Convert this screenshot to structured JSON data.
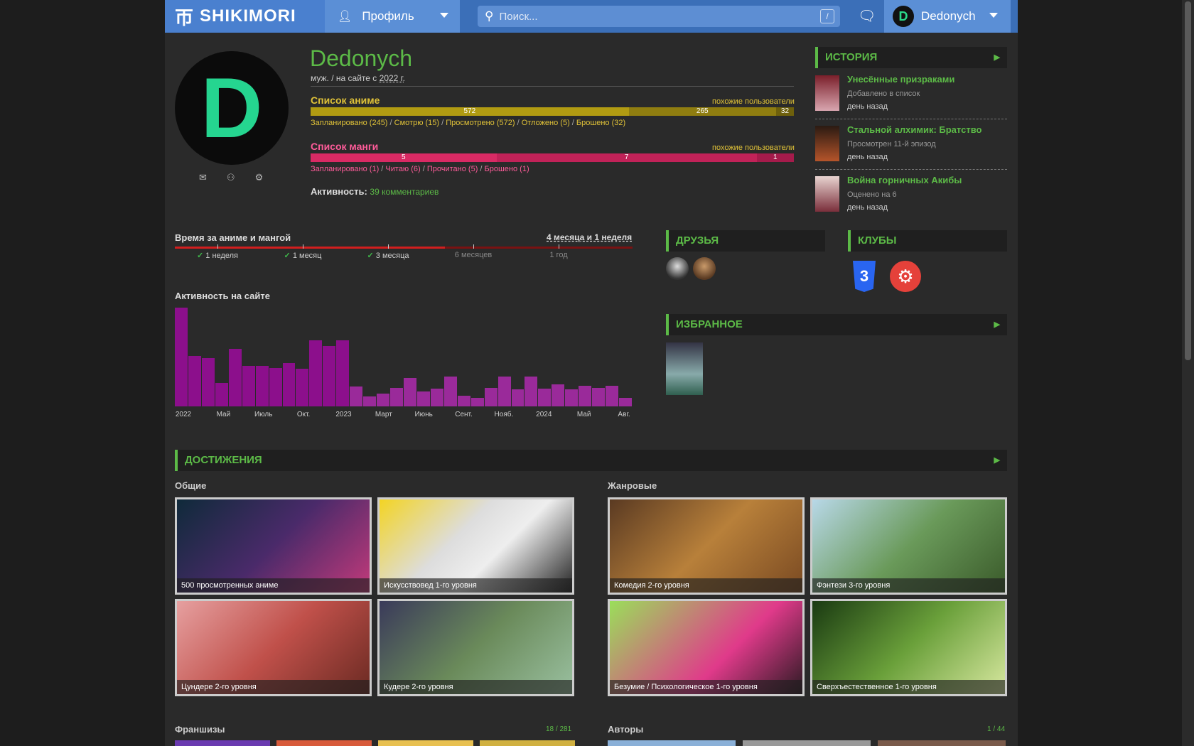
{
  "header": {
    "logo": "SHIKIMORI",
    "profile_menu": "Профиль",
    "search_placeholder": "Поиск...",
    "search_hotkey": "/",
    "username": "Dedonych"
  },
  "profile": {
    "name": "Dedonych",
    "gender": "муж.",
    "since_prefix": "на сайте с",
    "since_year": "2022 г.",
    "activity_label": "Активность:",
    "activity_value": "39 комментариев"
  },
  "anime_list": {
    "title": "Список аниме",
    "similar": "похожие пользователи",
    "segments": [
      {
        "label": "572",
        "value": 572,
        "color": "#b19b12"
      },
      {
        "label": "265",
        "value": 265,
        "color": "#8f7d10"
      },
      {
        "label": "32",
        "value": 32,
        "color": "#6e600c"
      }
    ],
    "counts": [
      {
        "label": "Запланировано",
        "n": "(245)"
      },
      {
        "label": "Смотрю",
        "n": "(15)"
      },
      {
        "label": "Просмотрено",
        "n": "(572)"
      },
      {
        "label": "Отложено",
        "n": "(5)"
      },
      {
        "label": "Брошено",
        "n": "(32)"
      }
    ],
    "accent": "#e0c238"
  },
  "manga_list": {
    "title": "Список манги",
    "similar": "похожие пользователи",
    "segments": [
      {
        "label": "5",
        "value": 5,
        "color": "#d92a64"
      },
      {
        "label": "7",
        "value": 7,
        "color": "#c12258"
      },
      {
        "label": "1",
        "value": 1,
        "color": "#a51b4b"
      }
    ],
    "counts": [
      {
        "label": "Запланировано",
        "n": "(1)"
      },
      {
        "label": "Читаю",
        "n": "(6)"
      },
      {
        "label": "Прочитано",
        "n": "(5)"
      },
      {
        "label": "Брошено",
        "n": "(1)"
      }
    ],
    "accent": "#ff5c9a"
  },
  "history": {
    "title": "ИСТОРИЯ",
    "items": [
      {
        "title": "Унесённые призраками",
        "status": "Добавлено в список",
        "time": "день назад"
      },
      {
        "title": "Стальной алхимик: Братство",
        "status": "Просмотрен 11-й эпизод",
        "time": "день назад"
      },
      {
        "title": "Война горничных Акибы",
        "status": "Оценено на 6",
        "time": "день назад"
      }
    ]
  },
  "time_spent": {
    "title": "Время за аниме и мангой",
    "total": "4 месяца и 1 неделя",
    "progress": 0.59,
    "marks": [
      {
        "label": "1 неделя",
        "done": true
      },
      {
        "label": "1 месяц",
        "done": true
      },
      {
        "label": "3 месяца",
        "done": true
      },
      {
        "label": "6 месяцев",
        "done": false
      },
      {
        "label": "1 год",
        "done": false
      }
    ]
  },
  "activity_chart": {
    "title": "Активность на сайте",
    "chart_data": {
      "type": "bar",
      "values": [
        100,
        51,
        49,
        24,
        58,
        41,
        41,
        39,
        44,
        38,
        67,
        61,
        67,
        20,
        10,
        13,
        19,
        29,
        15,
        18,
        30,
        11,
        9,
        19,
        30,
        17,
        30,
        18,
        22,
        17,
        21,
        19,
        21,
        9
      ],
      "tick_labels": [
        "2022",
        "Май",
        "Июль",
        "Окт.",
        "2023",
        "Март",
        "Июнь",
        "Сент.",
        "Нояб.",
        "2024",
        "Май",
        "Авг."
      ],
      "colors": [
        "#8c0f8c",
        "#9a2a9a"
      ]
    }
  },
  "friends": {
    "title": "ДРУЗЬЯ"
  },
  "clubs": {
    "title": "КЛУБЫ"
  },
  "favourites": {
    "title": "ИЗБРАННОЕ"
  },
  "achievements": {
    "title": "ДОСТИЖЕНИЯ",
    "common_title": "Общие",
    "genre_title": "Жанровые",
    "common": [
      {
        "label": "500 просмотренных аниме",
        "border": "#3d8fa3"
      },
      {
        "label": "Искусствовед 1-го уровня",
        "border": "#e8c71a"
      },
      {
        "label": "Цундере 2-го уровня",
        "border": "#d9703a"
      },
      {
        "label": "Кудере 2-го уровня",
        "border": "#555555"
      }
    ],
    "genre": [
      {
        "label": "Комедия 2-го уровня",
        "border": "#a31a1a"
      },
      {
        "label": "Фэнтези 3-го уровня",
        "border": "#ccd6e6"
      },
      {
        "label": "Безумие / Психологическое 1-го уровня",
        "border": "#c72b7c"
      },
      {
        "label": "Сверхъестественное 1-го уровня",
        "border": "#8bc142"
      }
    ],
    "franchises_title": "Франшизы",
    "franchises_count": "18 / 281",
    "authors_title": "Авторы",
    "authors_count": "1 / 44"
  }
}
